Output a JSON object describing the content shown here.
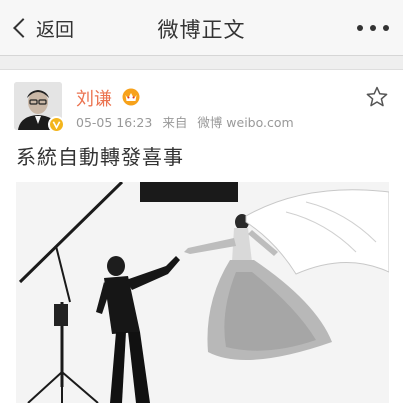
{
  "navbar": {
    "back_label": "返回",
    "title": "微博正文"
  },
  "post": {
    "author": {
      "name": "刘谦",
      "verified": true
    },
    "meta": {
      "timestamp": "05-05 16:23",
      "source_prefix": "来自",
      "source": "微博 weibo.com"
    },
    "text": "系統自動轉發喜事",
    "image": {
      "kind": "black-and-white wedding photo"
    }
  },
  "icons": {
    "back": "chevron-left-icon",
    "more": "more-dots-icon",
    "star": "star-outline-icon",
    "vip": "vip-crown-icon",
    "verify": "verified-badge-icon"
  },
  "colors": {
    "username": "#eb7350",
    "verify_badge": "#f3b51d",
    "meta_text": "#999999"
  }
}
